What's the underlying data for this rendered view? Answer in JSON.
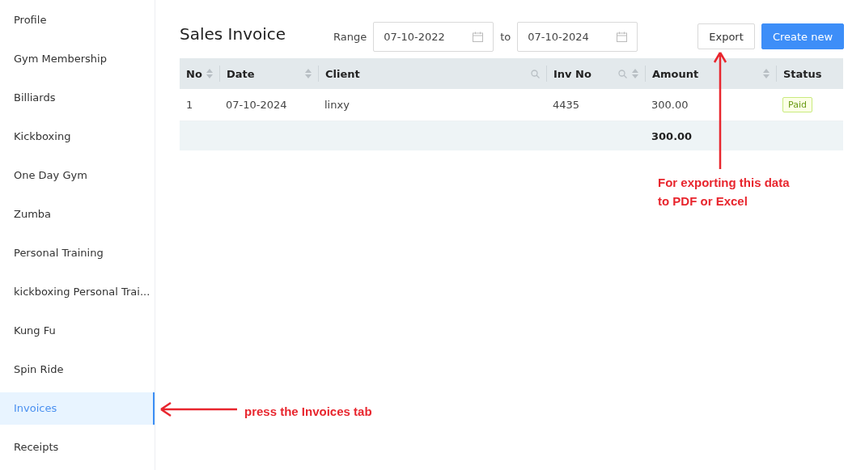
{
  "sidebar": {
    "items": [
      {
        "label": "Profile",
        "selected": false
      },
      {
        "label": "Gym Membership",
        "selected": false
      },
      {
        "label": "Billiards",
        "selected": false
      },
      {
        "label": "Kickboxing",
        "selected": false
      },
      {
        "label": "One Day Gym",
        "selected": false
      },
      {
        "label": "Zumba",
        "selected": false
      },
      {
        "label": "Personal Training",
        "selected": false
      },
      {
        "label": "kickboxing Personal Trai...",
        "selected": false
      },
      {
        "label": "Kung Fu",
        "selected": false
      },
      {
        "label": "Spin Ride",
        "selected": false
      },
      {
        "label": "Invoices",
        "selected": true
      },
      {
        "label": "Receipts",
        "selected": false
      }
    ]
  },
  "page_title": "Sales Invoice",
  "range": {
    "label": "Range",
    "from": "07-10-2022",
    "separator": "to",
    "to": "07-10-2024"
  },
  "buttons": {
    "export": "Export",
    "create": "Create new"
  },
  "table": {
    "columns": [
      {
        "label": "No",
        "sortable": true,
        "searchable": false
      },
      {
        "label": "Date",
        "sortable": true,
        "searchable": false
      },
      {
        "label": "Client",
        "sortable": false,
        "searchable": true
      },
      {
        "label": "Inv No",
        "sortable": true,
        "searchable": true
      },
      {
        "label": "Amount",
        "sortable": true,
        "searchable": false
      },
      {
        "label": "Status",
        "sortable": false,
        "searchable": false
      }
    ],
    "rows": [
      {
        "no": "1",
        "date": "07-10-2024",
        "client": "linxy",
        "inv_no": "4435",
        "amount": "300.00",
        "status": {
          "label": "Paid",
          "kind": "paid"
        }
      }
    ],
    "total": "300.00"
  },
  "annotations": [
    {
      "kind": "left",
      "text": "press the Invoices tab"
    },
    {
      "kind": "up",
      "text": "For exporting this data to PDF or Excel"
    }
  ]
}
